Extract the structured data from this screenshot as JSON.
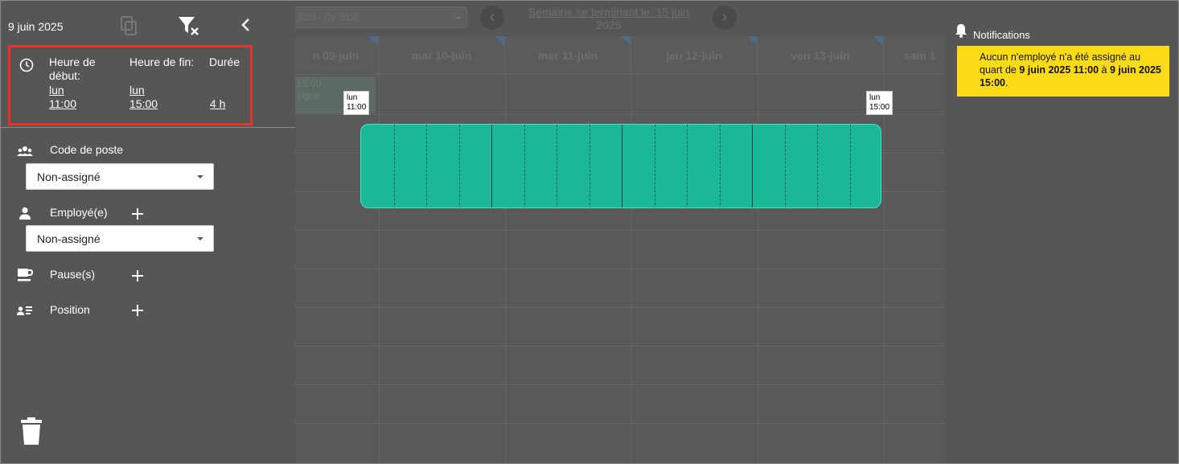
{
  "calendar": {
    "location_select": "3333 - CV 3333",
    "week_label_line1": "Semaine se terminant le: 15 juin",
    "week_label_line2": "2025",
    "days": [
      "n 09-juin",
      "mar 10-juin",
      "mer 11-juin",
      "jeu 12-juin",
      "ven 13-juin",
      "sam 1"
    ],
    "ghost_shift_line1": "15:00",
    "ghost_shift_line2": "signé",
    "start_tag_day": "lun",
    "start_tag_time": "11:00",
    "end_tag_day": "lun",
    "end_tag_time": "15:00",
    "shift_color": "#1ab896"
  },
  "panel": {
    "date": "9 juin 2025",
    "start_label_line1": "Heure de",
    "start_label_line2": "début:",
    "end_label": "Heure de fin:",
    "duration_label": "Durée",
    "start_day": "lun",
    "start_time": "11:00",
    "end_day": "lun",
    "end_time": "15:00",
    "duration_value": "4 h",
    "job_code_label": "Code de poste",
    "job_code_value": "Non-assigné",
    "employee_label": "Employé(e)",
    "employee_value": "Non-assigné",
    "breaks_label": "Pause(s)",
    "position_label": "Position",
    "highlight_color": "#e8352b"
  },
  "notifications": {
    "title": "Notifications",
    "message_part1": "Aucun n'employé n'a été assigné au quart de ",
    "message_start": "9 juin 2025 11:00",
    "message_part2": " à ",
    "message_end": "9 juin 2025 15:00",
    "message_part3": ".",
    "card_color": "#fedb14"
  }
}
